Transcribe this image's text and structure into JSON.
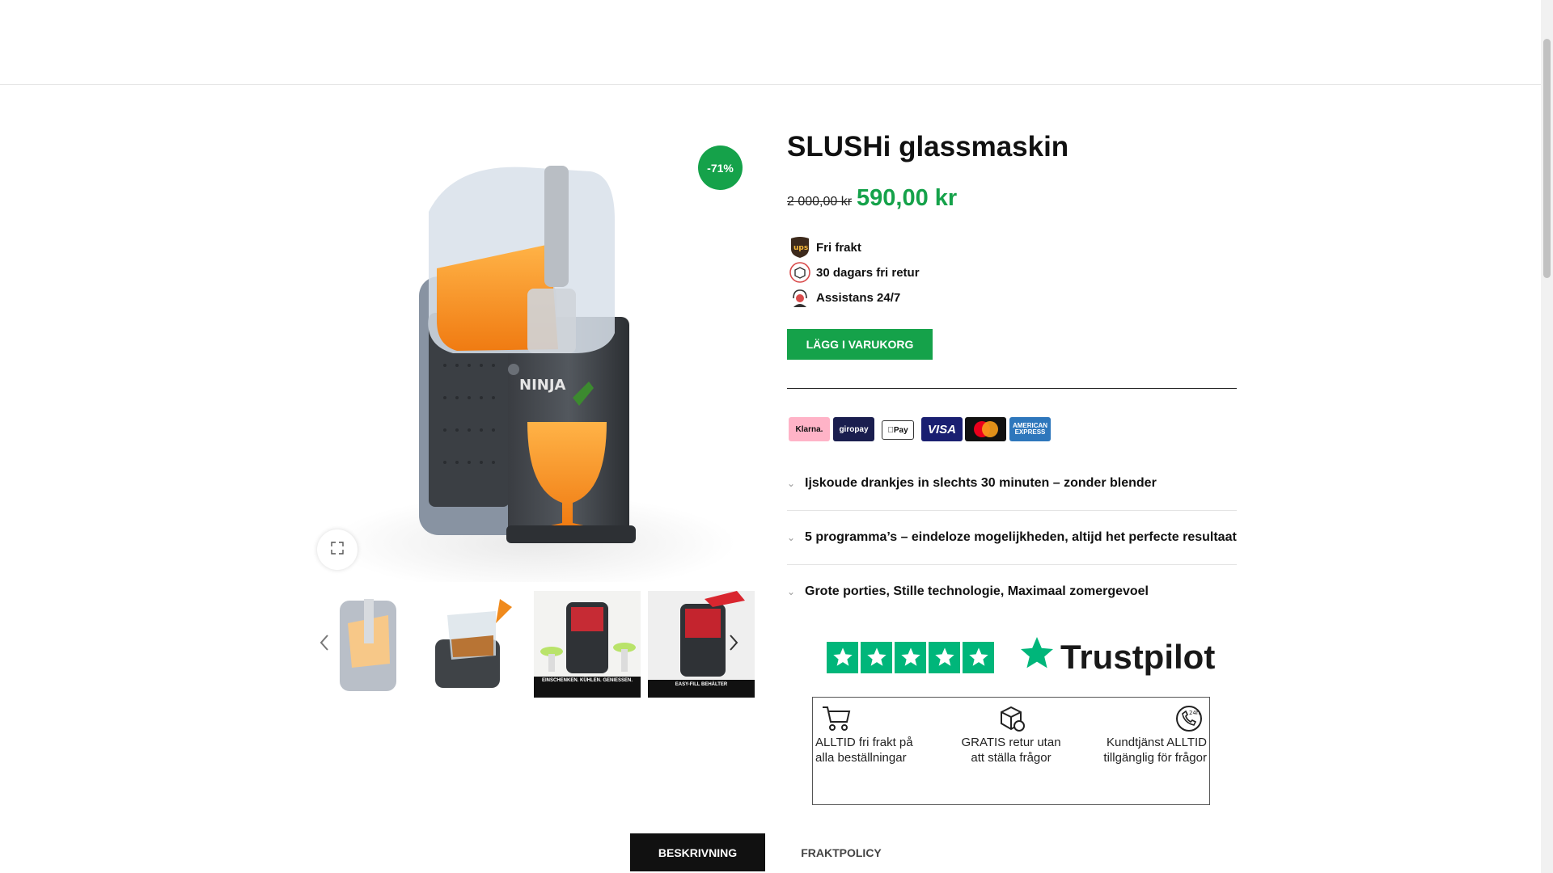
{
  "product": {
    "title": "SLUSHi glassmaskin",
    "old_price": "2 000,00 kr",
    "new_price": "590,00 kr",
    "discount_badge": "-71%",
    "brand_on_machine": "NINJA"
  },
  "perks": [
    {
      "icon": "ups-icon",
      "label": "Fri frakt"
    },
    {
      "icon": "return-box-icon",
      "label": "30 dagars fri retur"
    },
    {
      "icon": "support-agent-icon",
      "label": "Assistans 24/7"
    }
  ],
  "add_to_cart_label": "LÄGG I VARUKORG",
  "payment_methods": [
    "Klarna.",
    "giropay",
    "Pay",
    "VISA",
    "mastercard",
    "AMERICAN EXPRESS"
  ],
  "accordion": [
    "Ijskoude drankjes in slechts 30 minuten – zonder blender",
    "5 programma’s – eindeloze mogelijkheden, altijd het perfecte resultaat",
    "Grote porties, Stille technologie, Maximaal zomergevoel"
  ],
  "trustpilot_label": "Trustpilot",
  "usps": [
    {
      "icon": "cart-icon",
      "text": "ALLTID fri frakt på alla beställningar"
    },
    {
      "icon": "return-package-icon",
      "text": "GRATIS retur utan att ställa frågor"
    },
    {
      "icon": "phone-24h-icon",
      "text": "Kundtjänst ALLTID tillgänglig för frågor"
    }
  ],
  "thumb_captions": [
    "EINSCHENKEN. KÜHLEN. GENIESSEN.",
    "EASY-FILL BEHÄLTER"
  ],
  "tabs": [
    "BESKRIVNING",
    "FRAKTPOLICY"
  ],
  "colors": {
    "accent": "#15a24a",
    "trustpilot": "#00b67a"
  }
}
